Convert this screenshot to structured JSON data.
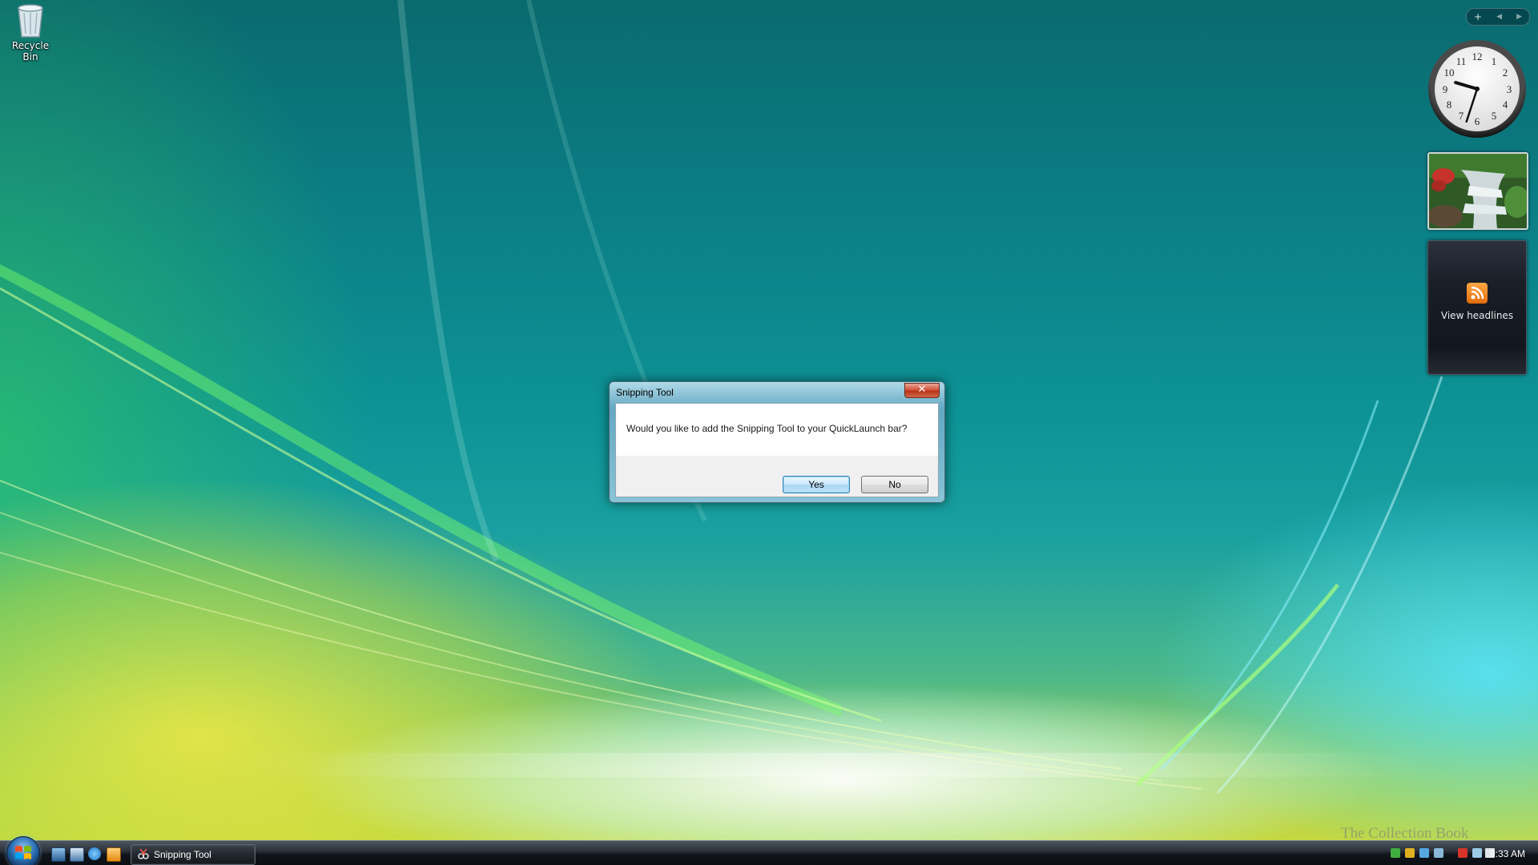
{
  "desktop": {
    "icons": [
      {
        "label": "Recycle Bin",
        "icon": "recycle-bin-icon"
      }
    ]
  },
  "sidebar": {
    "controls": {
      "add": "+",
      "prev": "◀",
      "next": "▶"
    },
    "clock": {
      "hour": 9,
      "minute": 33
    },
    "feed_gadget": {
      "caption": "View headlines",
      "icon": "rss-icon"
    }
  },
  "dialog": {
    "title": "Snipping Tool",
    "close_label": "✕",
    "message": "Would you like to add the Snipping Tool to your QuickLaunch bar?",
    "buttons": {
      "yes": "Yes",
      "no": "No"
    }
  },
  "taskbar": {
    "start_icon": "windows-logo-icon",
    "quick_launch": [
      "show-desktop-icon",
      "switch-windows-icon",
      "internet-explorer-icon",
      "media-player-icon"
    ],
    "tasks": [
      {
        "label": "Snipping Tool",
        "icon": "snipping-tool-icon"
      }
    ],
    "clock": "9:33 AM"
  },
  "watermark": "The Collection Book",
  "colors": {
    "accent": "#3c7fb1",
    "close_button": "#c7432a",
    "taskbar": "#1a1f26"
  }
}
